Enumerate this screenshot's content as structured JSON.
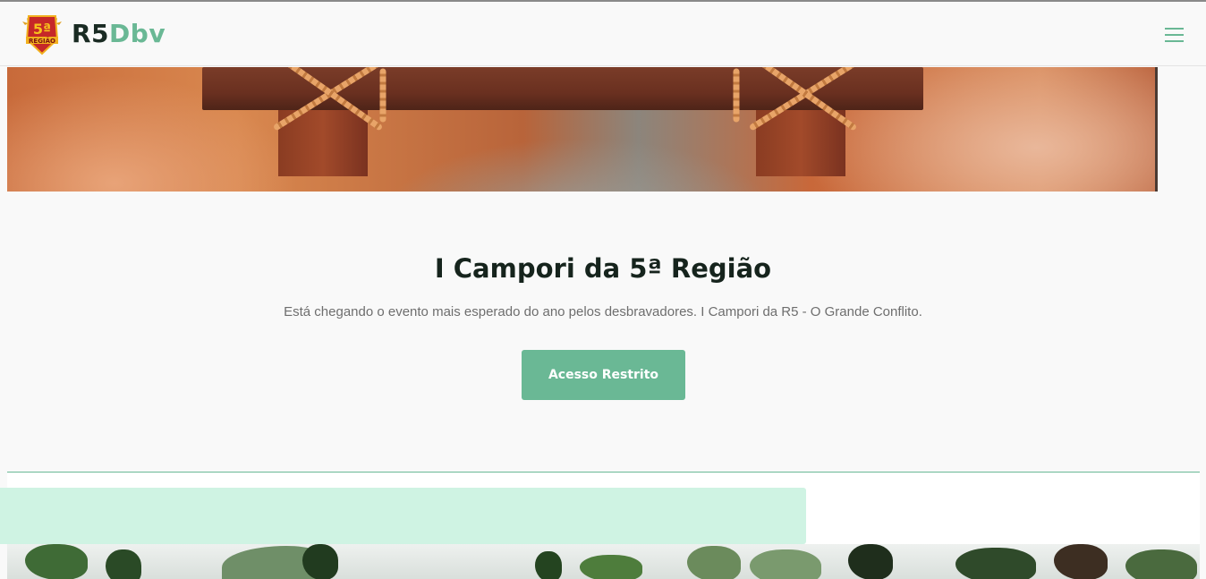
{
  "header": {
    "brand_part1": "R5",
    "brand_part2": "Dbv",
    "logo_text_top": "5ª",
    "logo_text_bottom": "REGIÃO",
    "menu_icon": "hamburger-menu-icon",
    "accent_color": "#6ab895"
  },
  "hero": {
    "image": "wooden-sign-with-rope-banner"
  },
  "main": {
    "title": "I Campori da 5ª Região",
    "subtitle": "Está chegando o evento mais esperado do ano pelos desbravadores. I Campori da R5 - O Grande Conflito.",
    "cta_label": "Acesso Restrito",
    "cta_color": "#6ab895"
  },
  "lower": {
    "bar_color": "#cff3e3",
    "photo": "trees-and-palms-photo"
  }
}
